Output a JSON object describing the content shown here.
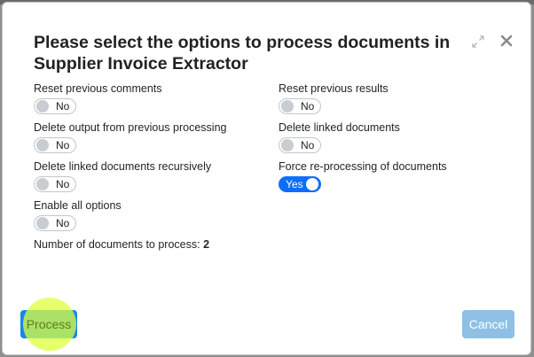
{
  "dialog": {
    "title": "Please select the options to process documents in Supplier Invoice Extractor"
  },
  "options": [
    {
      "label": "Reset previous comments",
      "value": "No"
    },
    {
      "label": "Reset previous results",
      "value": "No"
    },
    {
      "label": "Delete output from previous processing",
      "value": "No"
    },
    {
      "label": "Delete linked documents",
      "value": "No"
    },
    {
      "label": "Delete linked documents recursively",
      "value": "No"
    },
    {
      "label": "Force re-processing of documents",
      "value": "Yes"
    },
    {
      "label": "Enable all options",
      "value": "No"
    }
  ],
  "summary": {
    "label": "Number of documents to process:",
    "count": "2"
  },
  "buttons": {
    "process": "Process",
    "cancel": "Cancel"
  },
  "colors": {
    "toggle_on": "#0d6efd",
    "process_button": "#1a86e8",
    "cancel_button": "#8ec0e5",
    "cursor_highlight": "#deff3c"
  },
  "icons": {
    "expand": "expand-icon",
    "close": "close-icon"
  }
}
